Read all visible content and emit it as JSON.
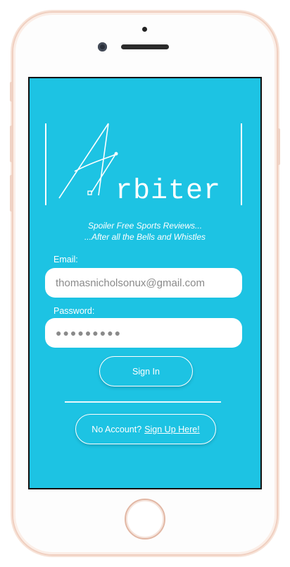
{
  "app": {
    "logo_text": "rbiter",
    "tagline_line1": "Spoiler Free Sports Reviews...",
    "tagline_line2": "...After all the Bells and Whistles"
  },
  "form": {
    "email_label": "Email:",
    "email_value": "thomasnicholsonux@gmail.com",
    "password_label": "Password:",
    "password_value": "●●●●●●●●●",
    "signin_label": "Sign In"
  },
  "footer": {
    "no_account_text": "No Account?",
    "signup_link": "Sign Up Here!"
  },
  "colors": {
    "background": "#1dc3e3",
    "text": "#ffffff",
    "input_bg": "#ffffff",
    "phone_frame": "#f0cfc0"
  }
}
